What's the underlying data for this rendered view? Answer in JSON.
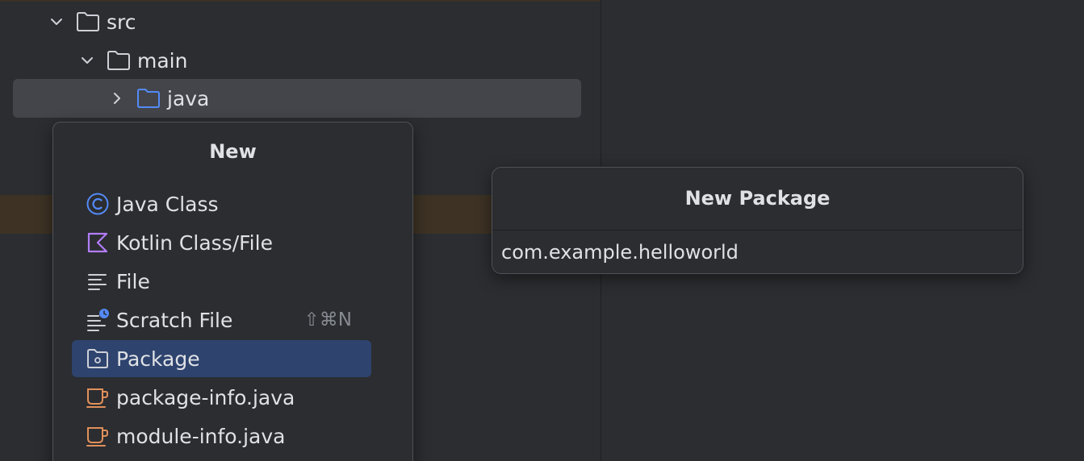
{
  "tree": {
    "items": [
      {
        "label": "src",
        "expanded": true
      },
      {
        "label": "main",
        "expanded": true
      },
      {
        "label": "java",
        "expanded": false,
        "selected": true
      }
    ]
  },
  "new_menu": {
    "title": "New",
    "items": [
      {
        "label": "Java Class",
        "icon": "java-class-icon"
      },
      {
        "label": "Kotlin Class/File",
        "icon": "kotlin-icon"
      },
      {
        "label": "File",
        "icon": "file-lines-icon"
      },
      {
        "label": "Scratch File",
        "icon": "scratch-file-icon",
        "shortcut": "⇧⌘N"
      },
      {
        "label": "Package",
        "icon": "package-folder-icon",
        "active": true
      },
      {
        "label": "package-info.java",
        "icon": "java-cup-icon"
      },
      {
        "label": "module-info.java",
        "icon": "java-cup-icon"
      }
    ]
  },
  "new_package_dialog": {
    "title": "New Package",
    "value": "com.example.helloworld"
  },
  "colors": {
    "background": "#2b2d30",
    "selection": "#43454a",
    "menu_active": "#2e436e",
    "java_class": "#548af7",
    "kotlin": "#b37dfe",
    "cup": "#e0905b"
  }
}
